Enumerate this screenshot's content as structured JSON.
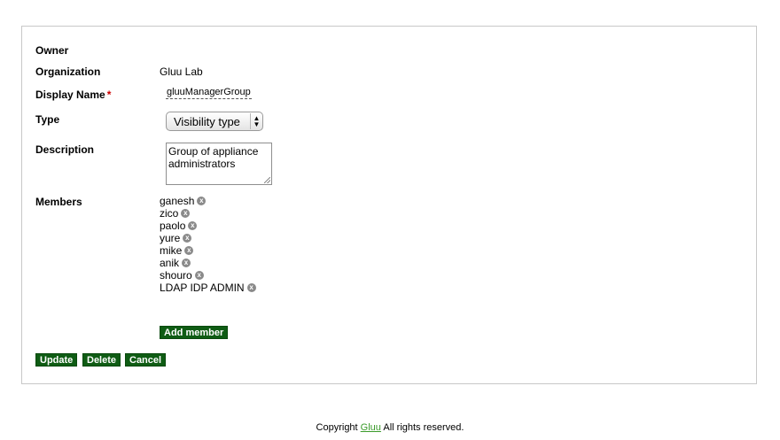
{
  "form": {
    "owner_label": "Owner",
    "organization_label": "Organization",
    "organization_value": "Gluu Lab",
    "display_name_label": "Display Name",
    "required_mark": "*",
    "display_name_value": "gluuManagerGroup",
    "type_label": "Type",
    "type_selected": "Visibility type",
    "description_label": "Description",
    "description_value": "Group of appliance administrators",
    "members_label": "Members",
    "members": [
      {
        "name": "ganesh"
      },
      {
        "name": "zico"
      },
      {
        "name": "paolo"
      },
      {
        "name": "yure"
      },
      {
        "name": "mike"
      },
      {
        "name": "anik"
      },
      {
        "name": "shouro"
      },
      {
        "name": "LDAP IDP ADMIN"
      }
    ],
    "remove_icon_glyph": "x",
    "add_member_label": "Add member"
  },
  "actions": {
    "update_label": "Update",
    "delete_label": "Delete",
    "cancel_label": "Cancel"
  },
  "footer": {
    "prefix": "Copyright",
    "link_text": "Gluu",
    "suffix": "All rights reserved."
  },
  "colors": {
    "button_bg": "#0f5c14",
    "required": "#cc0000",
    "footer_link": "#3a9a2a"
  },
  "icons": {
    "remove": "remove-member-icon",
    "select_arrows": "select-arrows-icon"
  }
}
